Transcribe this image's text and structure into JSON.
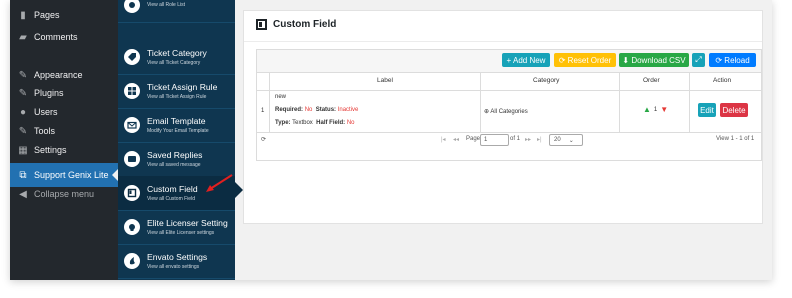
{
  "wp_menu": {
    "items": [
      {
        "icon": "pages-icon",
        "glyph": "▮",
        "label": "Pages"
      },
      {
        "icon": "comments-icon",
        "glyph": "▰",
        "label": "Comments"
      },
      {
        "icon": "appearance-icon",
        "glyph": "✎",
        "label": "Appearance"
      },
      {
        "icon": "plugins-icon",
        "glyph": "✎",
        "label": "Plugins"
      },
      {
        "icon": "users-icon",
        "glyph": "●",
        "label": "Users"
      },
      {
        "icon": "tools-icon",
        "glyph": "✎",
        "label": "Tools"
      },
      {
        "icon": "settings-icon",
        "glyph": "▦",
        "label": "Settings"
      }
    ],
    "active": {
      "icon": "support-icon",
      "glyph": "⧉",
      "label": "Support Genix Lite"
    },
    "collapse": {
      "icon": "collapse-icon",
      "glyph": "◀",
      "label": "Collapse menu"
    }
  },
  "plugin_menu": {
    "items": [
      {
        "title": "",
        "subtitle": "View all Role List"
      },
      {
        "title": "Ticket Category",
        "subtitle": "View all Ticket Category"
      },
      {
        "title": "Ticket Assign Rule",
        "subtitle": "View all Ticket Assign Rule"
      },
      {
        "title": "Email Template",
        "subtitle": "Modify Your Email Template"
      },
      {
        "title": "Saved Replies",
        "subtitle": "View all saved message"
      },
      {
        "title": "Custom Field",
        "subtitle": "View all Custom Field"
      },
      {
        "title": "Elite Licenser Setting",
        "subtitle": "View all Elite Licenser settings"
      },
      {
        "title": "Envato Settings",
        "subtitle": "View all envato settings"
      }
    ]
  },
  "page": {
    "title": "Custom Field"
  },
  "toolbar": {
    "add_new": "+ Add New",
    "reset_order": "⟳ Reset Order",
    "download_csv": "⬇ Download CSV",
    "reload": "⟳ Reload"
  },
  "table": {
    "columns": [
      "Label",
      "Category",
      "Order",
      "Action"
    ],
    "rows": [
      {
        "num": "1",
        "name": "new",
        "required_label": "Required:",
        "required_value": "No",
        "status_label": "Status:",
        "status_value": "Inactive",
        "type_label": "Type:",
        "type_value": "Textbox",
        "half_label": "Half Field:",
        "half_value": "No",
        "category": "⊕ All Categories",
        "order": "1",
        "edit": "Edit",
        "delete": "Delete"
      }
    ]
  },
  "pager": {
    "refresh": "⟳",
    "nav_first": "|◂",
    "nav_prev": "◂◂",
    "page_label": "Page",
    "page_value": "1",
    "of_label": "of 1",
    "nav_next": "▸▸",
    "nav_last": "▸|",
    "per_page": "20",
    "summary": "View 1 - 1 of 1"
  },
  "colors": {
    "add_new": "#17a2b8",
    "reset_order": "#ffc107",
    "download_csv": "#28a745",
    "expand": "#17a2b8",
    "reload": "#007bff",
    "delete": "#dc3545",
    "edit": "#17a2b8"
  }
}
